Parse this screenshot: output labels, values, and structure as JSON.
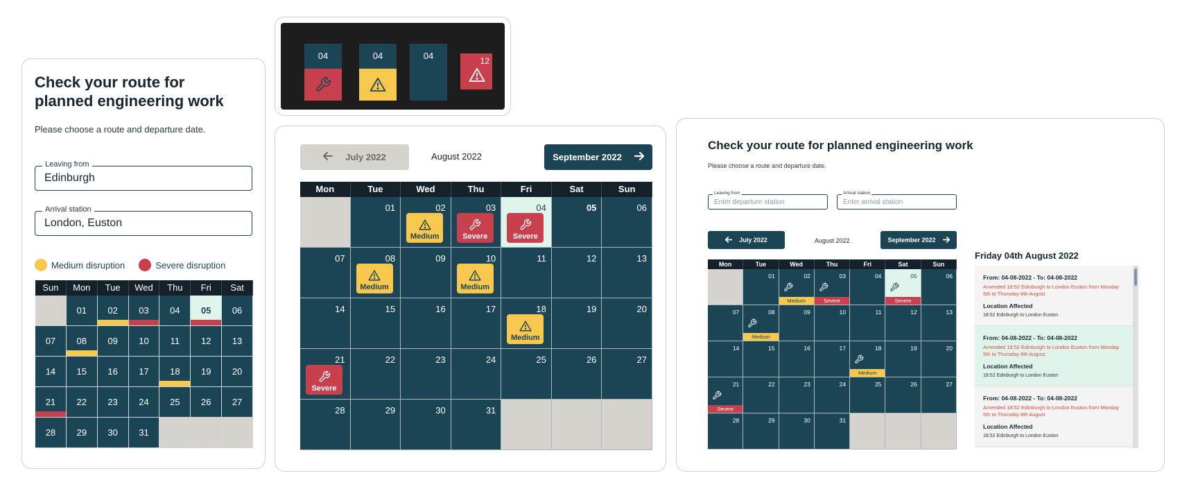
{
  "colors": {
    "navy": "#1b4454",
    "header": "#14202a",
    "medium": "#f8c84e",
    "severe": "#c8404e",
    "selected": "#dff4ea",
    "empty": "#d6d3ce",
    "amended_text": "#e0483f"
  },
  "mobile": {
    "title": "Check your route for planned engineering work",
    "subtitle": "Please choose a route and departure date.",
    "leaving_label": "Leaving from",
    "leaving_value": "Edinburgh",
    "arrival_label": "Arrival station",
    "arrival_value": "London, Euston",
    "legend": [
      {
        "label": "Medium disruption",
        "level": "medium"
      },
      {
        "label": "Severe disruption",
        "level": "severe"
      }
    ],
    "weekdays": [
      "Sun",
      "Mon",
      "Tue",
      "Wed",
      "Thu",
      "Fri",
      "Sat"
    ],
    "days": [
      {
        "n": ""
      },
      {
        "n": "01"
      },
      {
        "n": "02",
        "d": "medium"
      },
      {
        "n": "03",
        "d": "severe"
      },
      {
        "n": "04"
      },
      {
        "n": "05",
        "d": "severe",
        "sel": true
      },
      {
        "n": "06"
      },
      {
        "n": "07"
      },
      {
        "n": "08",
        "d": "medium"
      },
      {
        "n": "09"
      },
      {
        "n": "10"
      },
      {
        "n": "11"
      },
      {
        "n": "12"
      },
      {
        "n": "13"
      },
      {
        "n": "14"
      },
      {
        "n": "15"
      },
      {
        "n": "16"
      },
      {
        "n": "17"
      },
      {
        "n": "18",
        "d": "medium"
      },
      {
        "n": "19"
      },
      {
        "n": "20"
      },
      {
        "n": "21",
        "d": "severe"
      },
      {
        "n": "22"
      },
      {
        "n": "23"
      },
      {
        "n": "24"
      },
      {
        "n": "25"
      },
      {
        "n": "26"
      },
      {
        "n": "27"
      },
      {
        "n": "28"
      },
      {
        "n": "29"
      },
      {
        "n": "30"
      },
      {
        "n": "31"
      },
      {
        "n": ""
      },
      {
        "n": ""
      },
      {
        "n": ""
      }
    ]
  },
  "samples": {
    "tiles": [
      {
        "day": "04",
        "icon": "wrench",
        "level": "severe"
      },
      {
        "day": "04",
        "icon": "warning",
        "level": "medium"
      },
      {
        "day": "04",
        "icon": "none",
        "level": "none"
      }
    ],
    "badge": {
      "day": "12",
      "icon": "warning",
      "level": "severe"
    }
  },
  "desktop": {
    "prev_label": "July 2022",
    "month_label": "August 2022",
    "next_label": "September 2022",
    "weekdays": [
      "Mon",
      "Tue",
      "Wed",
      "Thu",
      "Fri",
      "Sat",
      "Sun"
    ],
    "days": [
      {
        "n": ""
      },
      {
        "n": "01"
      },
      {
        "n": "02",
        "d": "medium",
        "icon": "warning",
        "tag": "Medium"
      },
      {
        "n": "03",
        "d": "severe",
        "icon": "wrench",
        "tag": "Severe"
      },
      {
        "n": "04",
        "d": "severe",
        "icon": "wrench",
        "tag": "Severe",
        "sel": true
      },
      {
        "n": "05",
        "bold": true
      },
      {
        "n": "06"
      },
      {
        "n": "07"
      },
      {
        "n": "08",
        "d": "medium",
        "icon": "warning",
        "tag": "Medium"
      },
      {
        "n": "09"
      },
      {
        "n": "10",
        "d": "medium",
        "icon": "warning",
        "tag": "Medium"
      },
      {
        "n": "11"
      },
      {
        "n": "12"
      },
      {
        "n": "13"
      },
      {
        "n": "14"
      },
      {
        "n": "15"
      },
      {
        "n": "16"
      },
      {
        "n": "17"
      },
      {
        "n": "18",
        "d": "medium",
        "icon": "warning",
        "tag": "Medium"
      },
      {
        "n": "19"
      },
      {
        "n": "20"
      },
      {
        "n": "21",
        "d": "severe",
        "icon": "wrench",
        "tag": "Severe"
      },
      {
        "n": "22"
      },
      {
        "n": "23"
      },
      {
        "n": "24"
      },
      {
        "n": "25"
      },
      {
        "n": "26"
      },
      {
        "n": "27"
      },
      {
        "n": "28"
      },
      {
        "n": "29"
      },
      {
        "n": "30"
      },
      {
        "n": "31"
      },
      {
        "n": ""
      },
      {
        "n": ""
      },
      {
        "n": ""
      }
    ]
  },
  "wide": {
    "title": "Check your route for planned engineering work",
    "subtitle": "Please choose a route and departure date.",
    "leaving_label": "Leaving from",
    "leaving_placeholder": "Enter departure station",
    "arrival_label": "Arrival station",
    "arrival_placeholder": "Enter arrival station",
    "prev_label": "July 2022",
    "month_label": "August 2022",
    "next_label": "September 2022",
    "weekdays": [
      "Mon",
      "Tue",
      "Wed",
      "Thu",
      "Fri",
      "Sat",
      "Sun"
    ],
    "days": [
      {
        "n": ""
      },
      {
        "n": "01"
      },
      {
        "n": "02",
        "d": "medium",
        "tag": "Medium"
      },
      {
        "n": "03",
        "d": "severe",
        "tag": "Severe"
      },
      {
        "n": "04"
      },
      {
        "n": "05",
        "d": "severe",
        "tag": "Severe",
        "sel": true
      },
      {
        "n": "06"
      },
      {
        "n": "07"
      },
      {
        "n": "08",
        "d": "medium",
        "tag": "Medium"
      },
      {
        "n": "09"
      },
      {
        "n": "10"
      },
      {
        "n": "11"
      },
      {
        "n": "12"
      },
      {
        "n": "13"
      },
      {
        "n": "14"
      },
      {
        "n": "15"
      },
      {
        "n": "16"
      },
      {
        "n": "17"
      },
      {
        "n": "18",
        "d": "medium",
        "tag": "Medium"
      },
      {
        "n": "19"
      },
      {
        "n": "20"
      },
      {
        "n": "21",
        "d": "severe",
        "tag": "Severe"
      },
      {
        "n": "22"
      },
      {
        "n": "23"
      },
      {
        "n": "24"
      },
      {
        "n": "25"
      },
      {
        "n": "26"
      },
      {
        "n": "27"
      },
      {
        "n": "28"
      },
      {
        "n": "29"
      },
      {
        "n": "30"
      },
      {
        "n": "31"
      },
      {
        "n": ""
      },
      {
        "n": ""
      },
      {
        "n": ""
      }
    ],
    "selected_day_title": "Friday 04th August 2022",
    "entries": [
      {
        "range": "From: 04-08-2022 - To: 04-08-2022",
        "amended": "Amended 18:52 Edinburgh to London Euston from Monday 5th to Thursday 8th August",
        "location_heading": "Location Affected",
        "location": "18:52 Edinburgh to London Euston",
        "highlight": false
      },
      {
        "range": "From: 04-08-2022 - To: 04-08-2022",
        "amended": "Amended 18:52 Edinburgh to London Euston from Monday 5th to Thursday 8th August",
        "location_heading": "Location Affected",
        "location": "18:52 Edinburgh to London Euston",
        "highlight": true
      },
      {
        "range": "From: 04-08-2022 - To: 04-08-2022",
        "amended": "Amended 18:52 Edinburgh to London Euston from Monday 5th to Thursday 8th August",
        "location_heading": "Location Affected",
        "location": "18:52 Edinburgh to London Euston",
        "highlight": false
      }
    ]
  }
}
